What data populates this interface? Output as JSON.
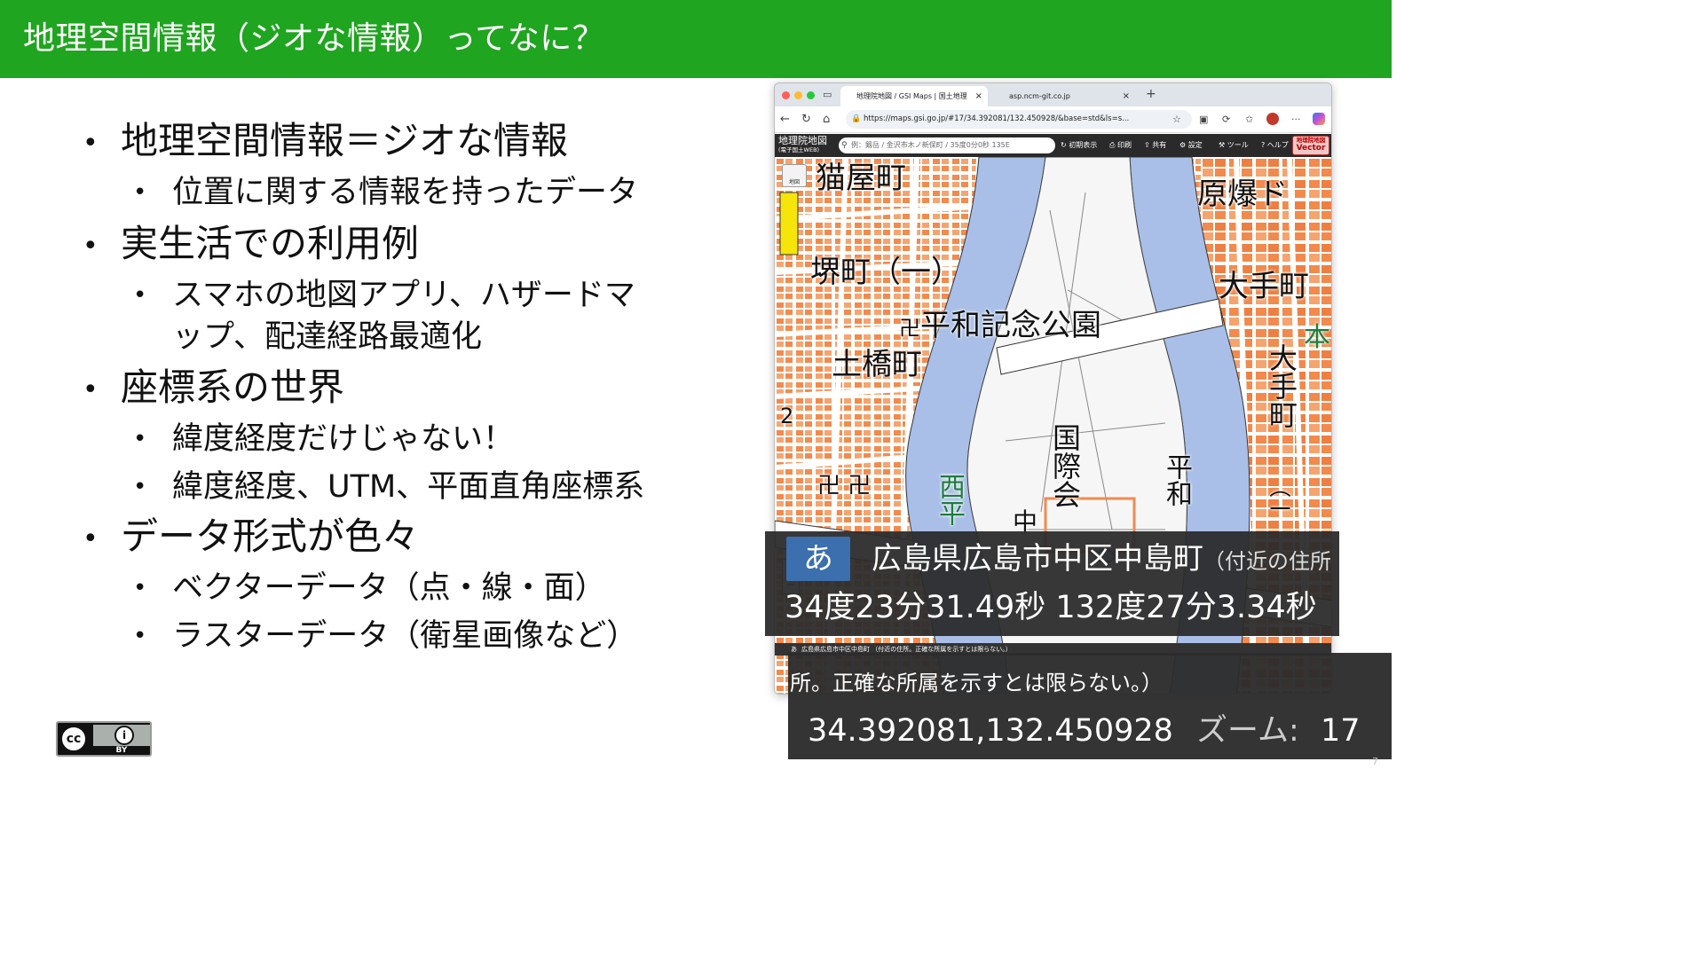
{
  "slide": {
    "title": "地理空間情報（ジオな情報）ってなに？",
    "bullets": {
      "b1": "地理空間情報＝ジオな情報",
      "b1_1": "位置に関する情報を持ったデータ",
      "b2": "実生活での利用例",
      "b2_1a": "スマホの地図アプリ、ハザードマ",
      "b2_1b": "ップ、配達経路最適化",
      "b3": "座標系の世界",
      "b3_1": "緯度経度だけじゃない！",
      "b3_2": "緯度経度、UTM、平面直角座標系",
      "b4": "データ形式が色々",
      "b4_1": "ベクターデータ（点・線・面）",
      "b4_2": "ラスターデータ（衛星画像など）"
    },
    "bullet_glyph": "•",
    "license": {
      "cc": "cc",
      "by": "BY",
      "person_glyph": "i"
    },
    "page_number": "7"
  },
  "browser": {
    "tabs": [
      {
        "label": "地理院地図 / GSI Maps | 国土地理",
        "close": "×"
      },
      {
        "label": "asp.ncm-git.co.jp",
        "close": "×"
      }
    ],
    "new_tab": "+",
    "url": "https://maps.gsi.go.jp/#17/34.392081/132.450928/&base=std&ls=s...",
    "colors": {
      "traffic_red": "#ff5f57",
      "traffic_yellow": "#febc2e",
      "traffic_green": "#28c840"
    }
  },
  "gsi": {
    "logo": "地理院地図",
    "logo_sub": "(電子国土WEB)",
    "search_placeholder": "例：剱岳 / 金沢市木ノ新保町 / 35度0分0秒 135E",
    "tools": {
      "home": "初期表示",
      "print": "印刷",
      "share": "共有",
      "settings": "設定",
      "tools": "ツール",
      "help": "ヘルプ"
    },
    "vector_top": "地理院地図",
    "vector_bottom": "Vector",
    "layer_label": "地図"
  },
  "map": {
    "labels": {
      "nekoya": "猫屋町",
      "genbaku": "原爆ド",
      "sakai": "堺町（一）",
      "otemachi": "大手町",
      "heiwa": "平和記念公園",
      "tsuchihashi": "土橋町",
      "otemachi_v": "大手町",
      "kokusai": "国際会",
      "heiwa_v": "平和",
      "nishi": "西平",
      "hon": "本",
      "two": "2",
      "one_v": "（一",
      "chu": "中",
      "manji": "卍",
      "manji2": "卍 卍"
    },
    "colors": {
      "river": "#a9bfe8",
      "building": "#f28a4d",
      "block": "#f6c8a6",
      "road": "#ffffff",
      "park": "#f5f5f5"
    },
    "zoom_plus": "+",
    "zoom_minus": "−",
    "mini_badge": "あ",
    "mini_address": "広島県広島市中区中島町",
    "mini_note": "（付近の住所。正確な所属を示すとは限らない。）"
  },
  "callout": {
    "badge": "あ",
    "address": "広島県広島市中区中島町",
    "address_note": "（付近の住所",
    "dms": "34度23分31.49秒 132度27分3.34秒",
    "note_full": "所。正確な所属を示すとは限らない。）",
    "latlon": "34.392081,132.450928",
    "zoom_label": "ズーム:",
    "zoom_value": "17"
  }
}
